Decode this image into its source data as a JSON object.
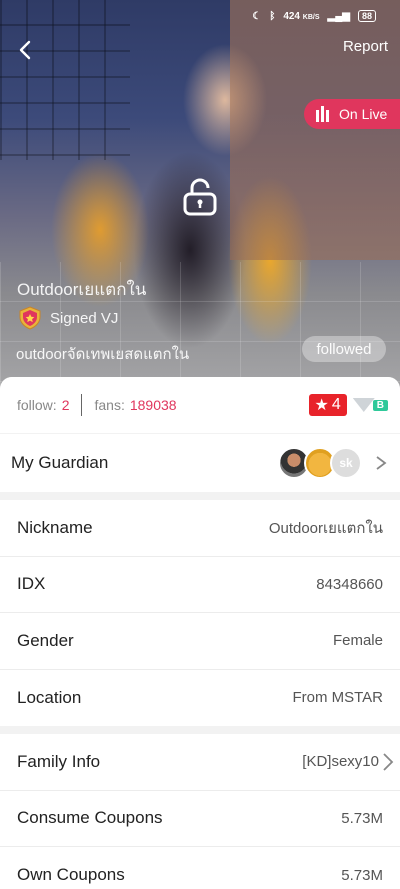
{
  "statusbar": {
    "speed": "424",
    "speed_unit": "KB/S",
    "battery": "88"
  },
  "header": {
    "report_label": "Report",
    "on_live_label": "On Live"
  },
  "hero": {
    "name": "Outdoorเยแตกใน",
    "signed_label": "Signed VJ",
    "description": "outdoorจัดเทพเยสดแตกใน",
    "followed_label": "followed"
  },
  "stats": {
    "follow_label": "follow:",
    "follow_count": "2",
    "fans_label": "fans:",
    "fans_count": "189038",
    "level": "4",
    "vip_badge": "B"
  },
  "guardian": {
    "label": "My Guardian",
    "third_avatar_text": "sk"
  },
  "profile": [
    {
      "label": "Nickname",
      "value": "Outdoorเยแตกใน"
    },
    {
      "label": "IDX",
      "value": "84348660"
    },
    {
      "label": "Gender",
      "value": "Female"
    },
    {
      "label": "Location",
      "value": "From MSTAR"
    }
  ],
  "extra": {
    "family_label": "Family Info",
    "family_value": "[KD]sexy10",
    "consume_label": "Consume Coupons",
    "consume_value": "5.73M",
    "own_label": "Own Coupons",
    "own_value": "5.73M"
  },
  "colors": {
    "accent": "#e0365d",
    "level_badge": "#e8232a",
    "vip_green": "#2fc99a"
  }
}
